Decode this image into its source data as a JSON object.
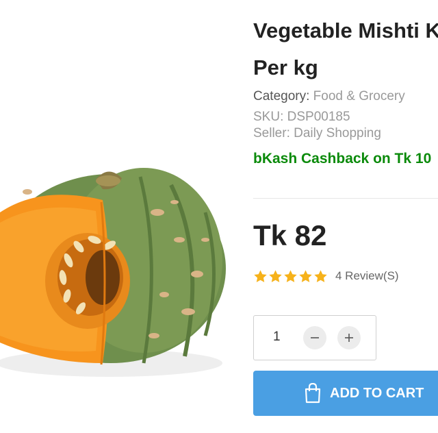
{
  "product": {
    "title_line1": "Vegetable Mishti K",
    "title_line2": "Per kg",
    "category_label": "Category: ",
    "category_value": "Food & Grocery",
    "sku": "SKU: DSP00185",
    "seller": "Seller: Daily Shopping",
    "cashback": "bKash Cashback on Tk 10",
    "price": "Tk 82",
    "rating": 5,
    "reviews": "4 Review(S)"
  },
  "quantity": {
    "value": "1"
  },
  "cart": {
    "label": "ADD TO CART"
  },
  "colors": {
    "cashback": "#0a8a0a",
    "star": "#f6b21b",
    "cart_button": "#4a9fe3",
    "pumpkin_flesh": "#f7941d",
    "pumpkin_rind": "#6f8f4d"
  },
  "image": {
    "subject": "pumpkin-icon"
  }
}
